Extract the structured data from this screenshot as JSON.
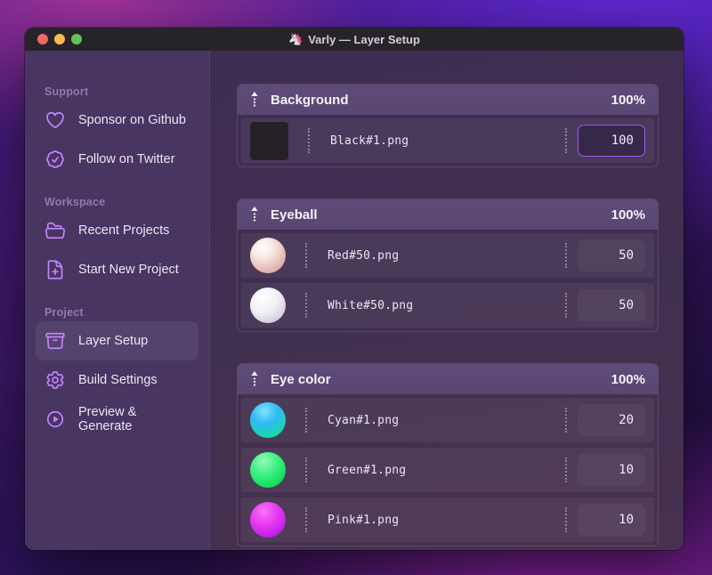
{
  "window": {
    "app_icon": "🦄",
    "title": "Varly — Layer Setup"
  },
  "titlebar_buttons": {
    "close_color": "#ee6a5f",
    "minimize_color": "#f5bd4f",
    "zoom_color": "#61c454"
  },
  "colors": {
    "accent": "#a855f7",
    "sidebar_icon": "#c084fc",
    "sidebar_bg": "#483562",
    "main_bg": "#3f2e54",
    "group_header_bg": "#5d4a78"
  },
  "sidebar": {
    "sections": [
      {
        "label": "Support",
        "items": [
          {
            "icon": "heart-icon",
            "label": "Sponsor on Github",
            "active": false
          },
          {
            "icon": "badge-check-icon",
            "label": "Follow on Twitter",
            "active": false
          }
        ]
      },
      {
        "label": "Workspace",
        "items": [
          {
            "icon": "folder-open-icon",
            "label": "Recent Projects",
            "active": false
          },
          {
            "icon": "document-plus-icon",
            "label": "Start New Project",
            "active": false
          }
        ]
      },
      {
        "label": "Project",
        "items": [
          {
            "icon": "archive-box-icon",
            "label": "Layer Setup",
            "active": true
          },
          {
            "icon": "gear-icon",
            "label": "Build Settings",
            "active": false
          },
          {
            "icon": "play-circle-icon",
            "label": "Preview & Generate",
            "active": false
          }
        ]
      }
    ]
  },
  "main": {
    "groups": [
      {
        "name": "Background",
        "weight": "100%",
        "layers": [
          {
            "file": "Black#1.png",
            "value": "100",
            "thumb": "black-square",
            "focused": true
          }
        ]
      },
      {
        "name": "Eyeball",
        "weight": "100%",
        "layers": [
          {
            "file": "Red#50.png",
            "value": "50",
            "thumb": "pearl-red",
            "focused": false
          },
          {
            "file": "White#50.png",
            "value": "50",
            "thumb": "pearl-white",
            "focused": false
          }
        ]
      },
      {
        "name": "Eye color",
        "weight": "100%",
        "layers": [
          {
            "file": "Cyan#1.png",
            "value": "20",
            "thumb": "sphere-cyan",
            "focused": false
          },
          {
            "file": "Green#1.png",
            "value": "10",
            "thumb": "sphere-green",
            "focused": false
          },
          {
            "file": "Pink#1.png",
            "value": "10",
            "thumb": "sphere-pink",
            "focused": false
          }
        ]
      }
    ]
  }
}
